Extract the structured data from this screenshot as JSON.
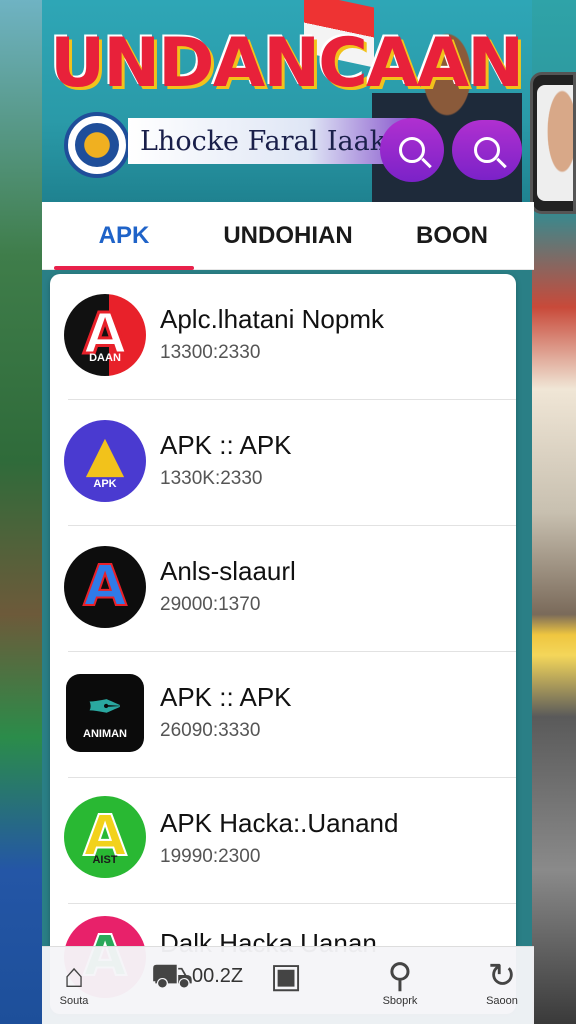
{
  "banner": {
    "title": "UNDANCAAN",
    "subtitle": "Lhocke Faral Iaakas"
  },
  "tabs": [
    {
      "label": "APK",
      "active": true
    },
    {
      "label": "UNDOHIAN",
      "active": false
    },
    {
      "label": "BOON",
      "active": false
    }
  ],
  "apps": [
    {
      "title": "Aplc.lhatani Nopmk",
      "subtitle": "13300:2330",
      "icon": "red-black-a-icon",
      "icon_caption": "DAAN",
      "bg": "#111111",
      "accent": "#e8212a"
    },
    {
      "title": "APK :: APK",
      "subtitle": "1330K:2330",
      "icon": "drive-triangle-icon",
      "icon_caption": "APK",
      "bg": "#4a3ad0",
      "accent": "#f2c21b"
    },
    {
      "title": "Anls-slaaurl",
      "subtitle": "29000:1370",
      "icon": "blue-red-a-icon",
      "icon_caption": "",
      "bg": "#0d0d0d",
      "accent": "#2f7be8"
    },
    {
      "title": "APK :: APK",
      "subtitle": "26090:3330",
      "icon": "pen-tool-icon",
      "icon_caption": "ANIMAN",
      "bg": "#0b0b0b",
      "accent": "#2aa8a0"
    },
    {
      "title": "APK Hacka:.Uanand",
      "subtitle": "19990:2300",
      "icon": "green-a-icon",
      "icon_caption": "AIST",
      "bg": "#29b833",
      "accent": "#f2d21b"
    },
    {
      "title": "Dalk Hacka Uanan",
      "subtitle": "",
      "icon": "pink-a-icon",
      "icon_caption": "",
      "bg": "#e8216a",
      "accent": "#2aa85a"
    }
  ],
  "bottom_nav": {
    "items": [
      {
        "label": "Souta",
        "icon": "home-icon"
      },
      {
        "label": "",
        "icon": "cart-icon"
      },
      {
        "label": "",
        "icon": "square-badge-icon"
      },
      {
        "label": "Sboprk",
        "icon": "search-icon"
      },
      {
        "label": "Saoon",
        "icon": "refresh-icon"
      }
    ],
    "time": "00.2Z"
  }
}
